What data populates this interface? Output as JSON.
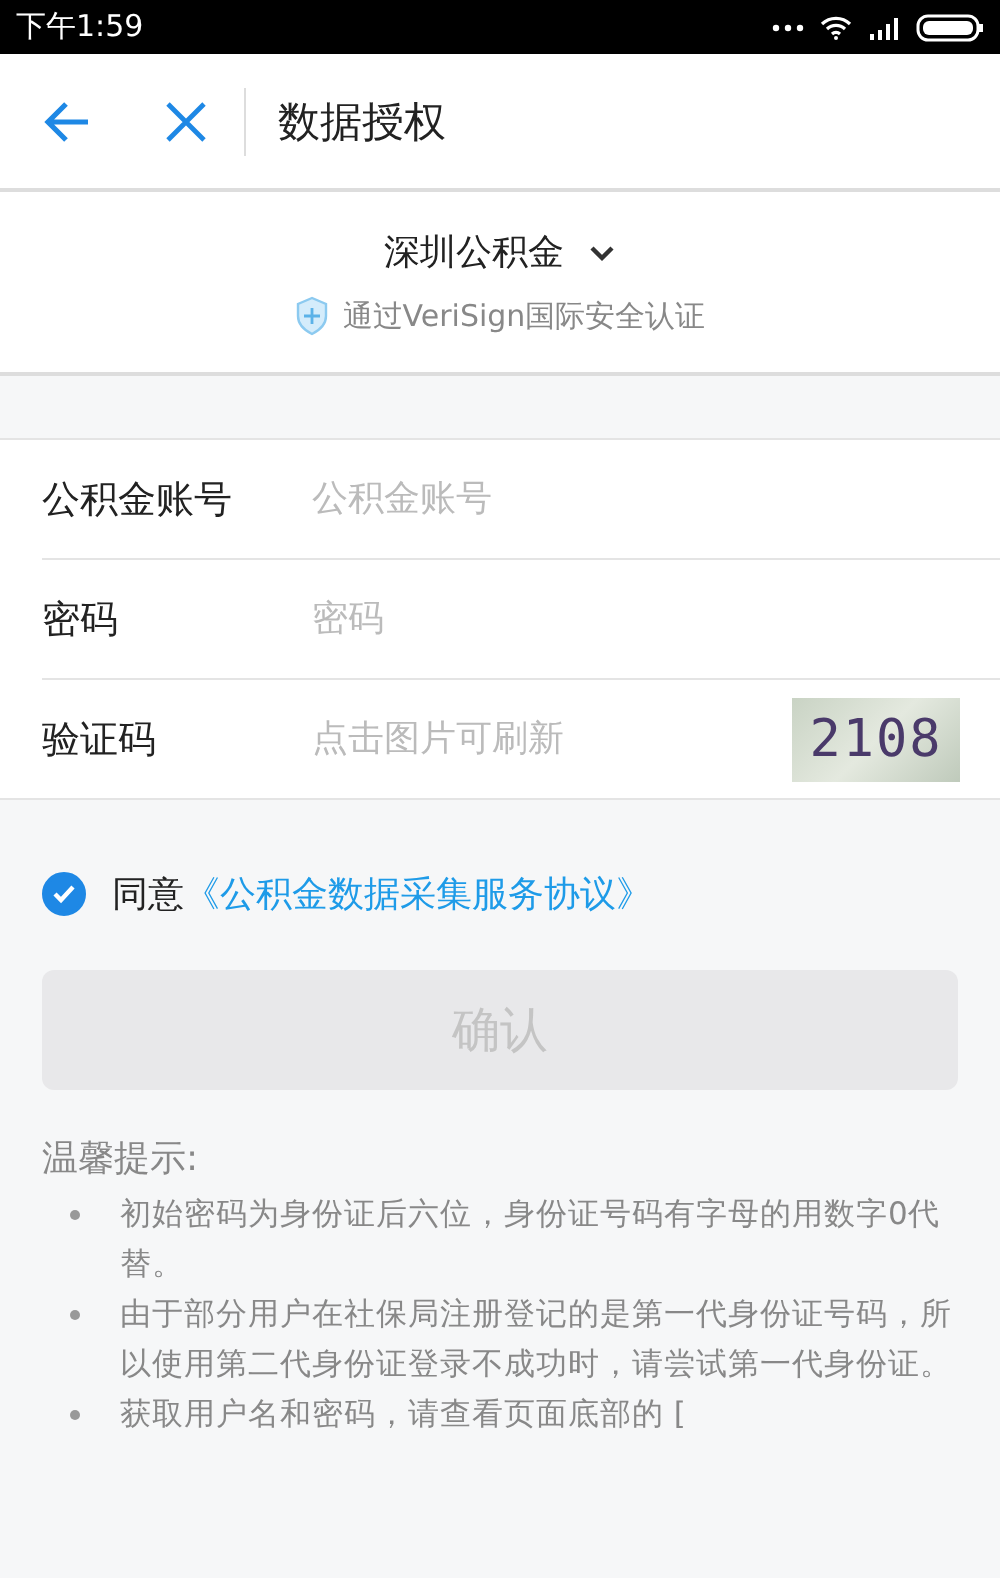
{
  "status_bar": {
    "time": "下午1:59"
  },
  "header": {
    "title": "数据授权"
  },
  "provider": {
    "name": "深圳公积金",
    "note": "通过VeriSign国际安全认证"
  },
  "fields": [
    {
      "kind": "text",
      "label": "公积金账号",
      "placeholder": "公积金账号"
    },
    {
      "kind": "password",
      "label": "密码",
      "placeholder": "密码"
    },
    {
      "kind": "captcha",
      "label": "验证码",
      "placeholder": "点击图片可刷新",
      "captcha": "2108"
    }
  ],
  "agreement": {
    "checked": true,
    "text": "同意",
    "link": "《公积金数据采集服务协议》"
  },
  "confirm_button": {
    "label": "确认",
    "disabled": true
  },
  "tips": {
    "title": "温馨提示:",
    "items": [
      "初始密码为身份证后六位，身份证号码有字母的用数字0代替。",
      "由于部分用户在社保局注册登记的是第一代身份证号码，所以使用第二代身份证登录不成功时，请尝试第一代身份证。",
      "获取用户名和密码，请查看页面底部的 ["
    ]
  }
}
